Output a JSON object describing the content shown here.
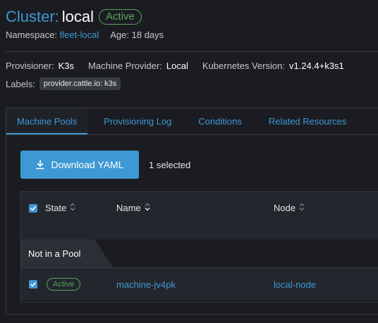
{
  "header": {
    "prefix": "Cluster:",
    "name": "local",
    "status": "Active"
  },
  "meta": {
    "namespace_label": "Namespace:",
    "namespace_value": "fleet-local",
    "age_label": "Age:",
    "age_value": "18 days"
  },
  "props": {
    "provisioner_label": "Provisioner:",
    "provisioner_value": "K3s",
    "machine_provider_label": "Machine Provider:",
    "machine_provider_value": "Local",
    "k8s_version_label": "Kubernetes Version:",
    "k8s_version_value": "v1.24.4+k3s1"
  },
  "labels": {
    "label": "Labels:",
    "tags": [
      "provider.cattle.io: k3s"
    ]
  },
  "tabs": [
    {
      "label": "Machine Pools",
      "active": true
    },
    {
      "label": "Provisioning Log",
      "active": false
    },
    {
      "label": "Conditions",
      "active": false
    },
    {
      "label": "Related Resources",
      "active": false
    }
  ],
  "toolbar": {
    "download_label": "Download YAML",
    "selected_text": "1 selected"
  },
  "table": {
    "columns": [
      "State",
      "Name",
      "Node"
    ],
    "group_label": "Not in a Pool",
    "rows": [
      {
        "state": "Active",
        "name": "machine-jv4pk",
        "node": "local-node",
        "checked": true
      }
    ]
  },
  "colors": {
    "accent": "#3d98d3",
    "success": "#5aa55a",
    "background": "#1b1c21"
  },
  "icons": {
    "download": "download-icon",
    "sort": "sort-icon",
    "sort_down": "sort-down-icon",
    "checkbox": "checkbox-checked-icon"
  }
}
